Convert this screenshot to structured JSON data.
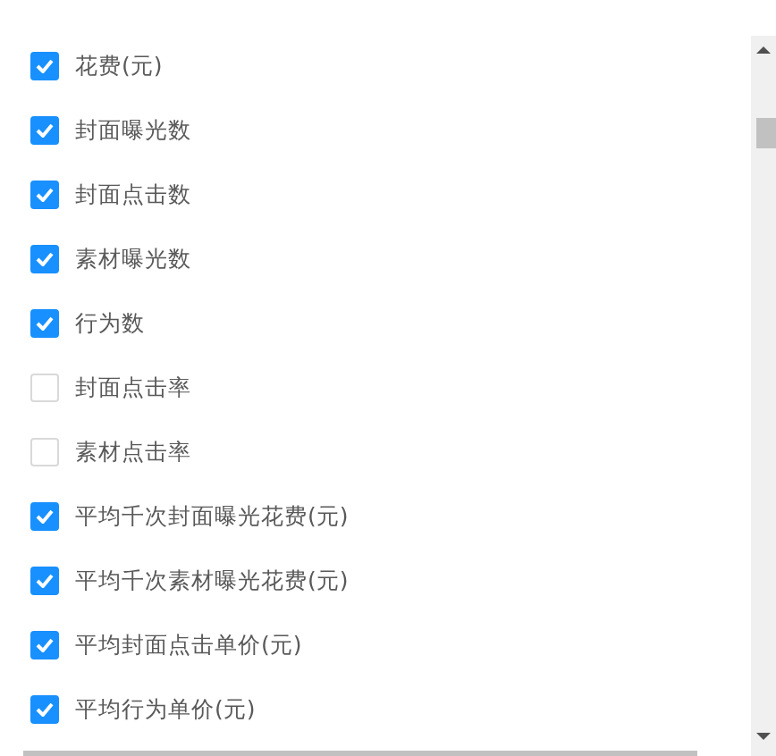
{
  "options": [
    {
      "label": "花费(元)",
      "checked": true
    },
    {
      "label": "封面曝光数",
      "checked": true
    },
    {
      "label": "封面点击数",
      "checked": true
    },
    {
      "label": "素材曝光数",
      "checked": true
    },
    {
      "label": "行为数",
      "checked": true
    },
    {
      "label": "封面点击率",
      "checked": false
    },
    {
      "label": "素材点击率",
      "checked": false
    },
    {
      "label": "平均千次封面曝光花费(元)",
      "checked": true
    },
    {
      "label": "平均千次素材曝光花费(元)",
      "checked": true
    },
    {
      "label": "平均封面点击单价(元)",
      "checked": true
    },
    {
      "label": "平均行为单价(元)",
      "checked": true
    }
  ]
}
